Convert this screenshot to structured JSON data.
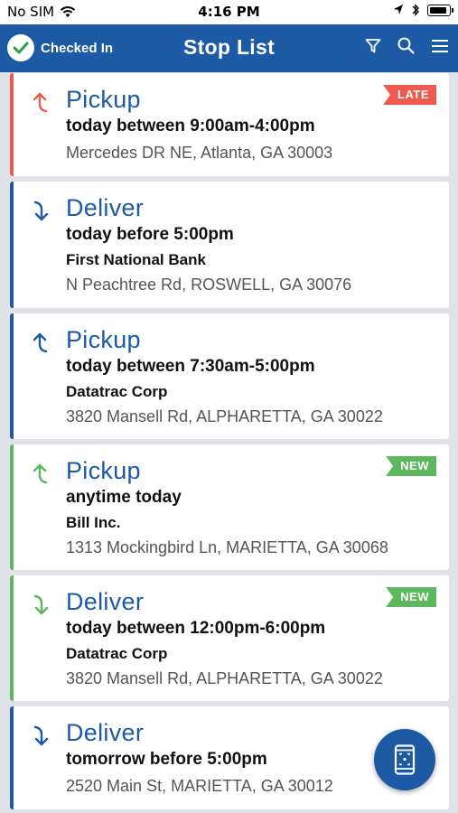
{
  "status_bar": {
    "carrier": "No SIM",
    "time": "4:16 PM",
    "icons": [
      "wifi-icon",
      "location-arrow-icon",
      "bluetooth-icon",
      "battery-icon"
    ]
  },
  "nav": {
    "checked_in_label": "Checked In",
    "title": "Stop List",
    "actions": [
      "filter-icon",
      "search-icon",
      "menu-icon"
    ]
  },
  "colors": {
    "primary": "#1c5aa6",
    "late": "#ee5a4d",
    "new": "#5cb85c"
  },
  "stops": [
    {
      "type": "Pickup",
      "direction": "up",
      "status": "late",
      "badge": "LATE",
      "time": "today between 9:00am-4:00pm",
      "company": "",
      "address": "Mercedes DR NE, Atlanta, GA 30003"
    },
    {
      "type": "Deliver",
      "direction": "down",
      "status": "normal",
      "badge": "",
      "time": "today before 5:00pm",
      "company": "First National Bank",
      "address": "N Peachtree Rd, ROSWELL, GA 30076"
    },
    {
      "type": "Pickup",
      "direction": "up",
      "status": "normal",
      "badge": "",
      "time": "today between 7:30am-5:00pm",
      "company": "Datatrac Corp",
      "address": "3820 Mansell Rd, ALPHARETTA, GA 30022"
    },
    {
      "type": "Pickup",
      "direction": "up",
      "status": "new",
      "badge": "NEW",
      "time": "anytime today",
      "company": "Bill Inc.",
      "address": "1313 Mockingbird Ln, MARIETTA, GA 30068"
    },
    {
      "type": "Deliver",
      "direction": "down",
      "status": "new",
      "badge": "NEW",
      "time": "today between 12:00pm-6:00pm",
      "company": "Datatrac Corp",
      "address": "3820 Mansell Rd, ALPHARETTA, GA 30022"
    },
    {
      "type": "Deliver",
      "direction": "down",
      "status": "normal",
      "badge": "",
      "time": "tomorrow before 5:00pm",
      "company": "",
      "address": "2520 Main St, MARIETTA, GA 30012"
    }
  ],
  "fab": {
    "icon": "mobile-scan-icon"
  }
}
